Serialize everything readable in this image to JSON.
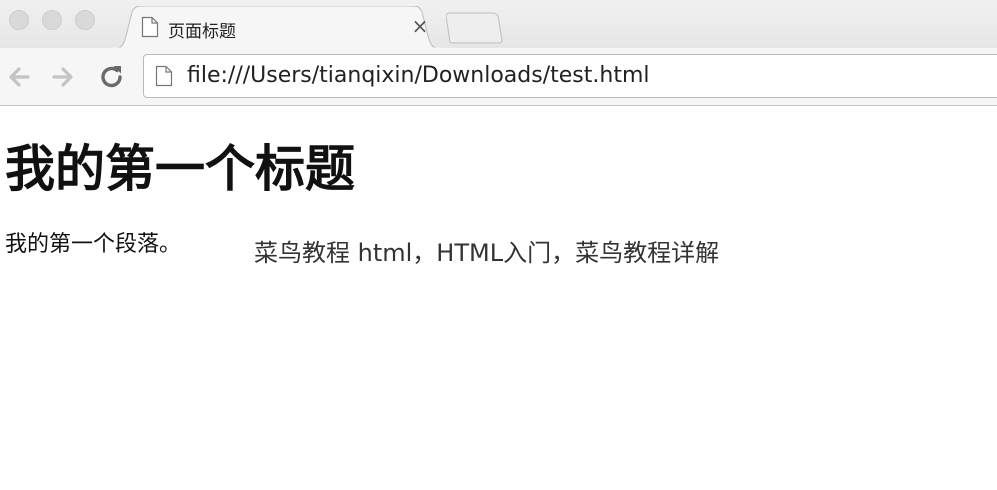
{
  "tab": {
    "title": "页面标题",
    "close_glyph": "×"
  },
  "toolbar": {
    "url": "file:///Users/tianqixin/Downloads/test.html"
  },
  "page": {
    "heading": "我的第一个标题",
    "paragraph": "我的第一个段落。",
    "overlay_caption": "菜鸟教程 html，HTML入门，菜鸟教程详解"
  },
  "icons": {
    "window_controls": [
      "window-close-icon",
      "window-minimize-icon",
      "window-zoom-icon"
    ],
    "tab_icon": "document-icon",
    "back": "back-arrow-icon",
    "forward": "forward-arrow-icon",
    "reload": "reload-icon",
    "omnibox_icon": "document-icon"
  },
  "colors": {
    "tabstrip_bg": "#e6e6e6",
    "toolbar_bg": "#f6f6f6",
    "text": "#111111"
  }
}
